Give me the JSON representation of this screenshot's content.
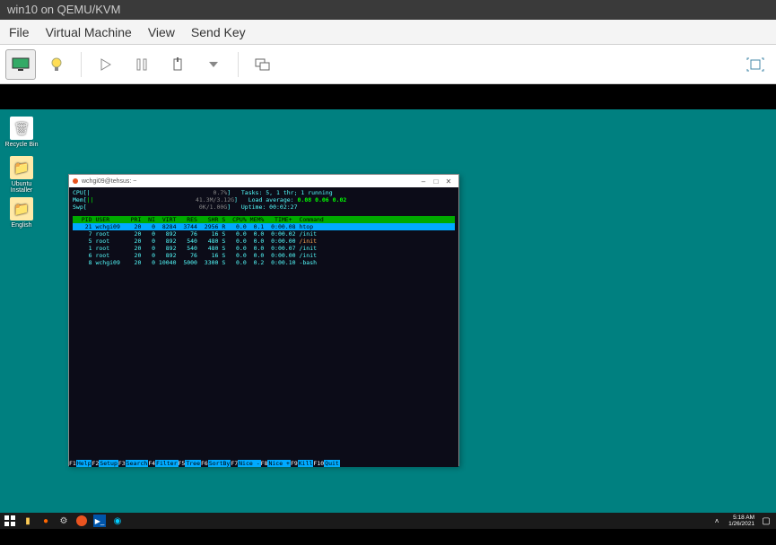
{
  "vm": {
    "title": "win10 on QEMU/KVM",
    "menu": {
      "file": "File",
      "virtual_machine": "Virtual Machine",
      "view": "View",
      "send_key": "Send Key"
    }
  },
  "desktop_icons": [
    {
      "name": "recycle-bin",
      "label": "Recycle Bin",
      "glyph": "🗑"
    },
    {
      "name": "ubuntu-installer",
      "label": "Ubuntu Installer",
      "glyph": "📁"
    },
    {
      "name": "english",
      "label": "English",
      "glyph": "📁"
    }
  ],
  "terminal": {
    "title": "wchgi09@tehsus: ~",
    "win_controls": {
      "min": "–",
      "max": "□",
      "close": "✕"
    },
    "htop": {
      "cpu": {
        "label": "CPU[",
        "bar": "|",
        "end": "]",
        "val": "0.7%"
      },
      "mem": {
        "label": "Mem[",
        "bar": "||",
        "end": "]",
        "val": "41.3M/3.12G"
      },
      "swp": {
        "label": "Swp[",
        "bar": "",
        "end": "]",
        "val": "0K/1.00G"
      },
      "tasks": "Tasks: 5, 1 thr; 1 running",
      "loadavg_label": "Load average:",
      "loadavg": "0.08 0.06 0.02",
      "uptime": "Uptime: 00:02:27",
      "header": "  PID USER      PRI  NI  VIRT   RES   SHR S  CPU% MEM%   TIME+  Command",
      "sel": "   21 wchgi09    20   0  8284  3744  2956 R   0.0  0.1  0:00.08 htop",
      "rows": [
        {
          "text": "    7 root       20   0   892    76    16 S   0.0  0.0  0:00.02 /init",
          "cmd": "/init"
        },
        {
          "text": "    5 root       20   0   892   540   480 S   0.0  0.0  0:00.00 ",
          "cmd": "/init",
          "hi": true
        },
        {
          "text": "    1 root       20   0   892   540   480 S   0.0  0.0  0:00.07 /init",
          "cmd": "/init"
        },
        {
          "text": "    6 root       20   0   892    76    16 S   0.0  0.0  0:00.00 /init",
          "cmd": "/init"
        },
        {
          "text": "    8 wchgi09    20   0 10040  5000  3300 S   0.0  0.2  0:00.10 -bash",
          "cmd": "-bash"
        }
      ],
      "footer": [
        {
          "k": "F1",
          "l": "Help"
        },
        {
          "k": "F2",
          "l": "Setup"
        },
        {
          "k": "F3",
          "l": "Search"
        },
        {
          "k": "F4",
          "l": "Filter"
        },
        {
          "k": "F5",
          "l": "Tree"
        },
        {
          "k": "F6",
          "l": "SortBy"
        },
        {
          "k": "F7",
          "l": "Nice -"
        },
        {
          "k": "F8",
          "l": "Nice +"
        },
        {
          "k": "F9",
          "l": "Kill"
        },
        {
          "k": "F10",
          "l": "Quit"
        }
      ]
    }
  },
  "taskbar": {
    "time": "5:18 AM",
    "date": "1/26/2021"
  }
}
